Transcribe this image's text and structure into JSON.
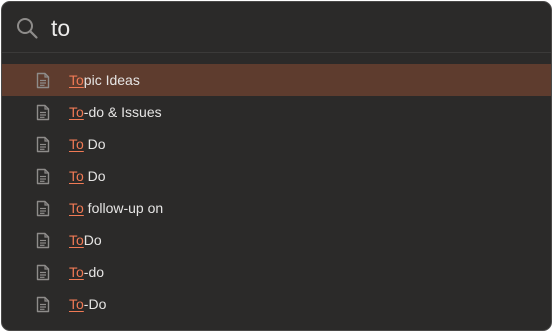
{
  "search": {
    "query": "to",
    "placeholder": ""
  },
  "results": [
    {
      "match": "To",
      "rest": "pic Ideas",
      "selected": true
    },
    {
      "match": "To",
      "rest": "-do & Issues",
      "selected": false
    },
    {
      "match": "To",
      "rest": " Do",
      "selected": false
    },
    {
      "match": "To",
      "rest": " Do",
      "selected": false
    },
    {
      "match": "To",
      "rest": " follow-up on",
      "selected": false
    },
    {
      "match": "To",
      "rest": "Do",
      "selected": false
    },
    {
      "match": "To",
      "rest": "-do",
      "selected": false
    },
    {
      "match": "To",
      "rest": "-Do",
      "selected": false
    }
  ],
  "colors": {
    "panel_bg": "#2b2a29",
    "selected_row_bg": "#5e3c2e",
    "match_accent": "#f07a55",
    "text": "#e6e5e4",
    "icon": "#8e8c8a"
  },
  "icons": {
    "search": "search-icon",
    "result": "document-icon"
  }
}
